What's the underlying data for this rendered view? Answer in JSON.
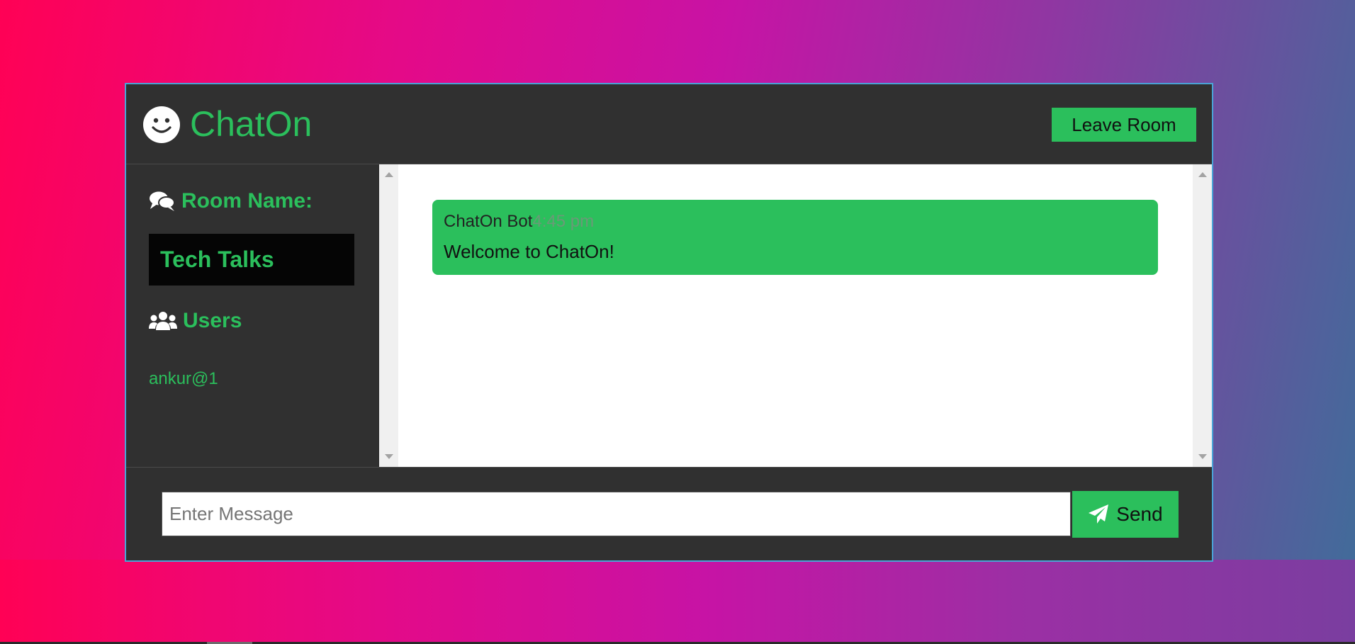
{
  "app": {
    "title": "ChatOn",
    "leave_label": "Leave Room"
  },
  "sidebar": {
    "room_heading": "Room Name:",
    "room_name": "Tech Talks",
    "users_heading": "Users",
    "users": [
      "ankur@1"
    ]
  },
  "messages": [
    {
      "author": "ChatOn Bot",
      "time": "4:45 pm",
      "text": "Welcome to ChatOn!"
    }
  ],
  "composer": {
    "placeholder": "Enter Message",
    "value": "",
    "send_label": "Send"
  },
  "icons": {
    "logo": "smiley-icon",
    "room": "comments-icon",
    "users": "users-icon",
    "send": "paper-plane-icon"
  },
  "colors": {
    "accent": "#2bbf5c",
    "panel": "#303030",
    "room_box": "#050505"
  }
}
